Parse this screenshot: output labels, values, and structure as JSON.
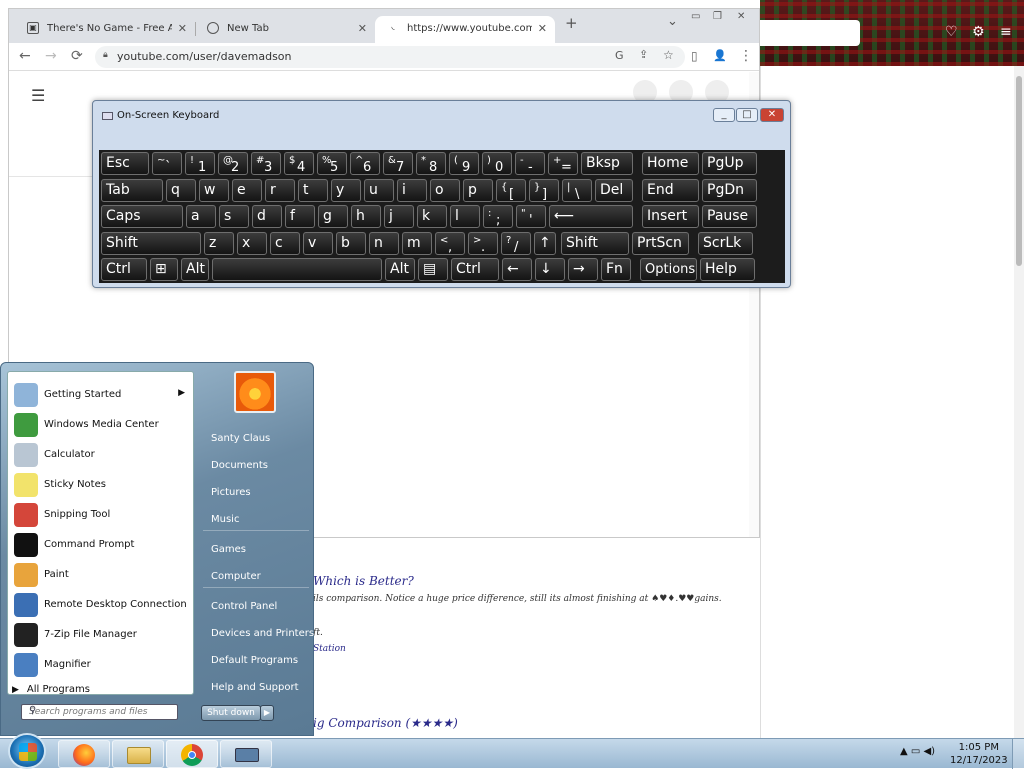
{
  "chrome": {
    "tabs": [
      {
        "title": "There's No Game - Free Addicting Games"
      },
      {
        "title": "New Tab"
      },
      {
        "title": "https://www.youtube.com/user/davemadson"
      }
    ],
    "new_tab": "+",
    "tab_search": "⌄",
    "window_controls": [
      "▭",
      "❐",
      "✕"
    ],
    "url": "youtube.com/user/davemadson",
    "nav": {
      "back": "←",
      "forward": "→",
      "reload": "⟳"
    },
    "toolbar_icons": [
      "G",
      "⇪",
      "☆",
      "▯",
      "👤",
      "⋮"
    ]
  },
  "youtube": {
    "menu_icon": "☰",
    "below_text": [
      "Which is Better?",
      "ils comparison. Notice a huge price difference, still its almost finishing at ♠♥♦.♥♥gains.",
      "ft.",
      "Station",
      "ig Comparison (★★★★)"
    ]
  },
  "osk": {
    "title": "On-Screen Keyboard",
    "buttons": [
      "_",
      "□",
      "✕"
    ],
    "rows": [
      [
        [
          "Esc",
          ""
        ],
        [
          "~",
          "`"
        ],
        [
          "!",
          "1"
        ],
        [
          "@",
          "2"
        ],
        [
          "#",
          "3"
        ],
        [
          "$",
          "4"
        ],
        [
          "%",
          "5"
        ],
        [
          "^",
          "6"
        ],
        [
          "&",
          "7"
        ],
        [
          "*",
          "8"
        ],
        [
          "(",
          "9"
        ],
        [
          ")",
          "0"
        ],
        [
          "-",
          "-"
        ],
        [
          "+",
          "="
        ],
        [
          "Bksp",
          ""
        ],
        [
          "Home",
          ""
        ],
        [
          "PgUp",
          ""
        ]
      ],
      [
        [
          "Tab",
          ""
        ],
        [
          "q",
          ""
        ],
        [
          "w",
          ""
        ],
        [
          "e",
          ""
        ],
        [
          "r",
          ""
        ],
        [
          "t",
          ""
        ],
        [
          "y",
          ""
        ],
        [
          "u",
          ""
        ],
        [
          "i",
          ""
        ],
        [
          "o",
          ""
        ],
        [
          "p",
          ""
        ],
        [
          "{",
          "["
        ],
        [
          "}",
          "]"
        ],
        [
          "|",
          "\\"
        ],
        [
          "Del",
          ""
        ],
        [
          "End",
          ""
        ],
        [
          "PgDn",
          ""
        ]
      ],
      [
        [
          "Caps",
          ""
        ],
        [
          "a",
          ""
        ],
        [
          "s",
          ""
        ],
        [
          "d",
          ""
        ],
        [
          "f",
          ""
        ],
        [
          "g",
          ""
        ],
        [
          "h",
          ""
        ],
        [
          "j",
          ""
        ],
        [
          "k",
          ""
        ],
        [
          "l",
          ""
        ],
        [
          ":",
          ";"
        ],
        [
          "\"",
          "'"
        ],
        [
          "⟵",
          ""
        ],
        [
          "Insert",
          ""
        ],
        [
          "Pause",
          ""
        ]
      ],
      [
        [
          "Shift",
          ""
        ],
        [
          "z",
          ""
        ],
        [
          "x",
          ""
        ],
        [
          "c",
          ""
        ],
        [
          "v",
          ""
        ],
        [
          "b",
          ""
        ],
        [
          "n",
          ""
        ],
        [
          "m",
          ""
        ],
        [
          "<",
          ","
        ],
        [
          ">",
          "."
        ],
        [
          "?",
          "/"
        ],
        [
          "↑",
          ""
        ],
        [
          "Shift",
          ""
        ],
        [
          "PrtScn",
          ""
        ],
        [
          "ScrLk",
          ""
        ]
      ],
      [
        [
          "Ctrl",
          ""
        ],
        [
          "⊞",
          ""
        ],
        [
          "Alt",
          ""
        ],
        [
          "",
          ""
        ],
        [
          "Alt",
          ""
        ],
        [
          "▤",
          ""
        ],
        [
          "Ctrl",
          ""
        ],
        [
          "←",
          ""
        ],
        [
          "↓",
          ""
        ],
        [
          "→",
          ""
        ],
        [
          "Fn",
          ""
        ],
        [
          "Options",
          ""
        ],
        [
          "Help",
          ""
        ]
      ]
    ]
  },
  "start_menu": {
    "programs": [
      {
        "label": "Getting Started",
        "icon": "getting-started-icon",
        "color": "#8fb4d9",
        "submenu": true
      },
      {
        "label": "Windows Media Center",
        "icon": "media-center-icon",
        "color": "#3f9b3f"
      },
      {
        "label": "Calculator",
        "icon": "calculator-icon",
        "color": "#b9c6d3"
      },
      {
        "label": "Sticky Notes",
        "icon": "sticky-notes-icon",
        "color": "#f2e36b"
      },
      {
        "label": "Snipping Tool",
        "icon": "snipping-tool-icon",
        "color": "#d4463a"
      },
      {
        "label": "Command Prompt",
        "icon": "command-prompt-icon",
        "color": "#111111"
      },
      {
        "label": "Paint",
        "icon": "paint-icon",
        "color": "#e8a43c"
      },
      {
        "label": "Remote Desktop Connection",
        "icon": "remote-desktop-icon",
        "color": "#3b6fb4"
      },
      {
        "label": "7-Zip File Manager",
        "icon": "seven-zip-icon",
        "color": "#222222"
      },
      {
        "label": "Magnifier",
        "icon": "magnifier-icon",
        "color": "#4a7fc1"
      }
    ],
    "all_programs": "All Programs",
    "search_placeholder": "Search programs and files",
    "right_items": [
      "Santy Claus",
      "Documents",
      "Pictures",
      "Music",
      "Games",
      "Computer",
      "Control Panel",
      "Devices and Printers",
      "Default Programs",
      "Help and Support"
    ],
    "shutdown": "Shut down",
    "shutdown_arrow": "▶"
  },
  "taskbar": {
    "apps": [
      "firefox-icon",
      "explorer-icon",
      "chrome-icon",
      "osk-icon"
    ],
    "tray": "▲ ▭ ◀)",
    "time": "1:05 PM",
    "date": "12/17/2023"
  }
}
